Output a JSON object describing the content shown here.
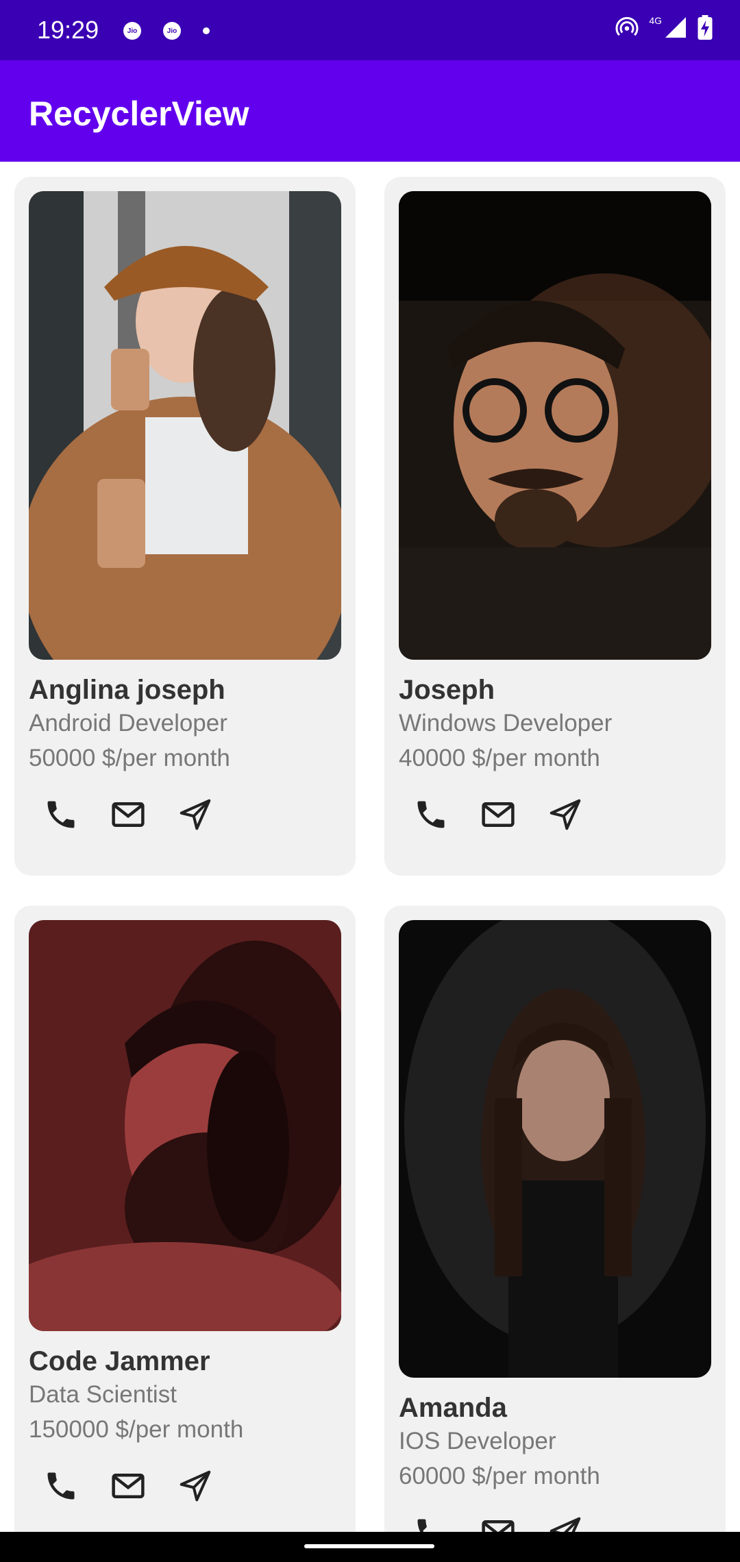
{
  "status_bar": {
    "time": "19:29",
    "carrier_1": "Jio",
    "carrier_2": "Jio",
    "network_label": "4G"
  },
  "app_bar": {
    "title": "RecyclerView"
  },
  "cards": [
    {
      "name": "Anglina joseph",
      "role": "Android Developer",
      "salary": "50000 $/per month"
    },
    {
      "name": "Joseph",
      "role": "Windows Developer",
      "salary": "40000 $/per month"
    },
    {
      "name": "Code Jammer",
      "role": "Data Scientist",
      "salary": "150000 $/per month"
    },
    {
      "name": "Amanda",
      "role": "IOS Developer",
      "salary": "60000 $/per month"
    }
  ],
  "icons": {
    "call": "phone-icon",
    "mail": "mail-icon",
    "send": "send-icon"
  },
  "colors": {
    "status_bar": "#3a00b3",
    "app_bar": "#6200ee",
    "card_bg": "#f1f1f1"
  }
}
